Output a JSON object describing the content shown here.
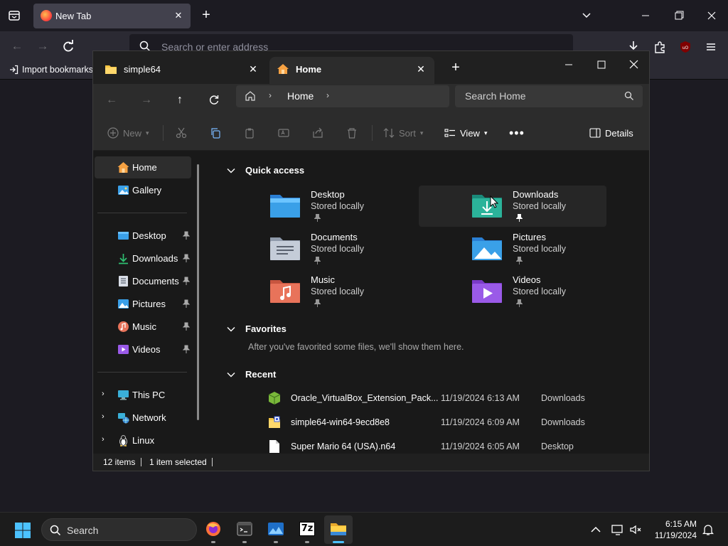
{
  "browser": {
    "tab_title": "New Tab",
    "url_placeholder": "Search or enter address",
    "import_bookmarks": "Import bookmarks"
  },
  "explorer": {
    "tabs": [
      {
        "title": "simple64",
        "icon": "folder-icon"
      },
      {
        "title": "Home",
        "icon": "home-icon",
        "active": true
      }
    ],
    "address": {
      "location": "Home"
    },
    "search": {
      "placeholder": "Search Home"
    },
    "toolbar": {
      "new_label": "New",
      "sort_label": "Sort",
      "view_label": "View",
      "details_label": "Details"
    },
    "sidebar": {
      "top": [
        {
          "label": "Home",
          "icon": "home-icon",
          "selected": true
        },
        {
          "label": "Gallery",
          "icon": "gallery-icon"
        }
      ],
      "pinned": [
        {
          "label": "Desktop",
          "icon": "desktop-icon"
        },
        {
          "label": "Downloads",
          "icon": "downloads-icon"
        },
        {
          "label": "Documents",
          "icon": "documents-icon"
        },
        {
          "label": "Pictures",
          "icon": "pictures-icon"
        },
        {
          "label": "Music",
          "icon": "music-icon"
        },
        {
          "label": "Videos",
          "icon": "videos-icon"
        }
      ],
      "locations": [
        {
          "label": "This PC",
          "icon": "pc-icon"
        },
        {
          "label": "Network",
          "icon": "network-icon"
        },
        {
          "label": "Linux",
          "icon": "linux-icon"
        }
      ]
    },
    "quick_access": {
      "title": "Quick access",
      "items": [
        {
          "name": "Desktop",
          "sub": "Stored locally"
        },
        {
          "name": "Downloads",
          "sub": "Stored locally"
        },
        {
          "name": "Documents",
          "sub": "Stored locally"
        },
        {
          "name": "Pictures",
          "sub": "Stored locally"
        },
        {
          "name": "Music",
          "sub": "Stored locally"
        },
        {
          "name": "Videos",
          "sub": "Stored locally"
        }
      ]
    },
    "favorites": {
      "title": "Favorites",
      "empty_text": "After you've favorited some files, we'll show them here."
    },
    "recent": {
      "title": "Recent",
      "rows": [
        {
          "name": "Oracle_VirtualBox_Extension_Pack...",
          "date": "11/19/2024 6:13 AM",
          "location": "Downloads",
          "icon": "package-icon"
        },
        {
          "name": "simple64-win64-9ecd8e8",
          "date": "11/19/2024 6:09 AM",
          "location": "Downloads",
          "icon": "zip-folder-icon"
        },
        {
          "name": "Super Mario 64 (USA).n64",
          "date": "11/19/2024 6:05 AM",
          "location": "Desktop",
          "icon": "file-icon"
        }
      ]
    },
    "status": {
      "items": "12 items",
      "selected": "1 item selected"
    }
  },
  "taskbar": {
    "search_label": "Search",
    "time": "6:15 AM",
    "date": "11/19/2024",
    "apps": [
      "firefox-icon",
      "terminal-icon",
      "app-icon",
      "7zip-icon",
      "file-explorer-icon"
    ],
    "zip_label": "7z",
    "accent": "#4cc2ff"
  }
}
